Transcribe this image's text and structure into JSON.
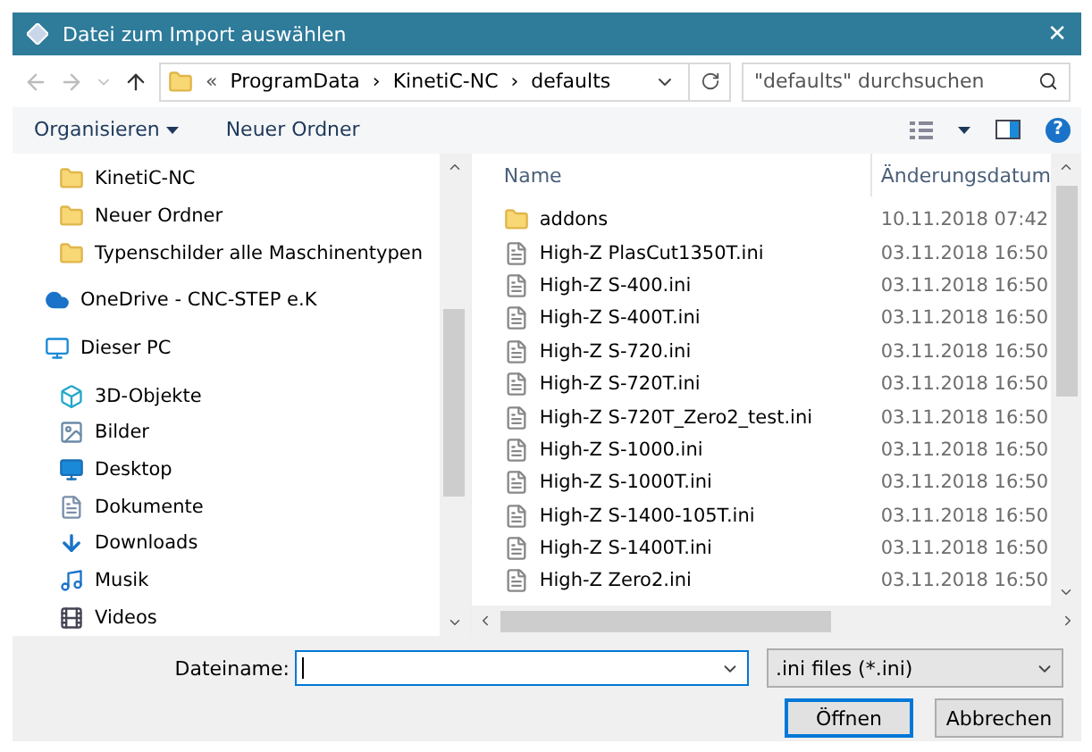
{
  "window": {
    "title": "Datei zum Import auswählen",
    "close": "✕"
  },
  "address": {
    "overflow": "«",
    "path": [
      "ProgramData",
      "KinetiC-NC",
      "defaults"
    ],
    "separator": "›",
    "search_placeholder": "\"defaults\" durchsuchen"
  },
  "toolbar": {
    "organize": "Organisieren",
    "new_folder": "Neuer Ordner",
    "help": "?"
  },
  "sidebar": {
    "items": [
      {
        "label": "KinetiC-NC",
        "kind": "folder"
      },
      {
        "label": "Neuer Ordner",
        "kind": "folder"
      },
      {
        "label": "Typenschilder alle Maschinentypen",
        "kind": "folder"
      },
      {
        "label": "OneDrive - CNC-STEP e.K",
        "kind": "cloud"
      },
      {
        "label": "Dieser PC",
        "kind": "pc"
      },
      {
        "label": "3D-Objekte",
        "kind": "cube"
      },
      {
        "label": "Bilder",
        "kind": "pictures"
      },
      {
        "label": "Desktop",
        "kind": "desktop"
      },
      {
        "label": "Dokumente",
        "kind": "document"
      },
      {
        "label": "Downloads",
        "kind": "download"
      },
      {
        "label": "Musik",
        "kind": "music"
      },
      {
        "label": "Videos",
        "kind": "video"
      }
    ]
  },
  "table": {
    "columns": [
      "Name",
      "Änderungsdatum"
    ],
    "rows": [
      {
        "name": "addons",
        "date": "10.11.2018 07:42",
        "kind": "folder"
      },
      {
        "name": "High-Z PlasCut1350T.ini",
        "date": "03.11.2018 16:50",
        "kind": "file"
      },
      {
        "name": "High-Z S-400.ini",
        "date": "03.11.2018 16:50",
        "kind": "file"
      },
      {
        "name": "High-Z S-400T.ini",
        "date": "03.11.2018 16:50",
        "kind": "file"
      },
      {
        "name": "High-Z S-720.ini",
        "date": "03.11.2018 16:50",
        "kind": "file"
      },
      {
        "name": "High-Z S-720T.ini",
        "date": "03.11.2018 16:50",
        "kind": "file"
      },
      {
        "name": "High-Z S-720T_Zero2_test.ini",
        "date": "03.11.2018 16:50",
        "kind": "file"
      },
      {
        "name": "High-Z S-1000.ini",
        "date": "03.11.2018 16:50",
        "kind": "file"
      },
      {
        "name": "High-Z S-1000T.ini",
        "date": "03.11.2018 16:50",
        "kind": "file"
      },
      {
        "name": "High-Z S-1400-105T.ini",
        "date": "03.11.2018 16:50",
        "kind": "file"
      },
      {
        "name": "High-Z S-1400T.ini",
        "date": "03.11.2018 16:50",
        "kind": "file"
      },
      {
        "name": "High-Z Zero2.ini",
        "date": "03.11.2018 16:50",
        "kind": "file"
      }
    ]
  },
  "footer": {
    "filename_label": "Dateiname:",
    "filter": ".ini files (*.ini)",
    "buttons": [
      {
        "label": "Öffnen",
        "selected": true
      },
      {
        "label": "Abbrechen",
        "selected": false
      }
    ]
  }
}
